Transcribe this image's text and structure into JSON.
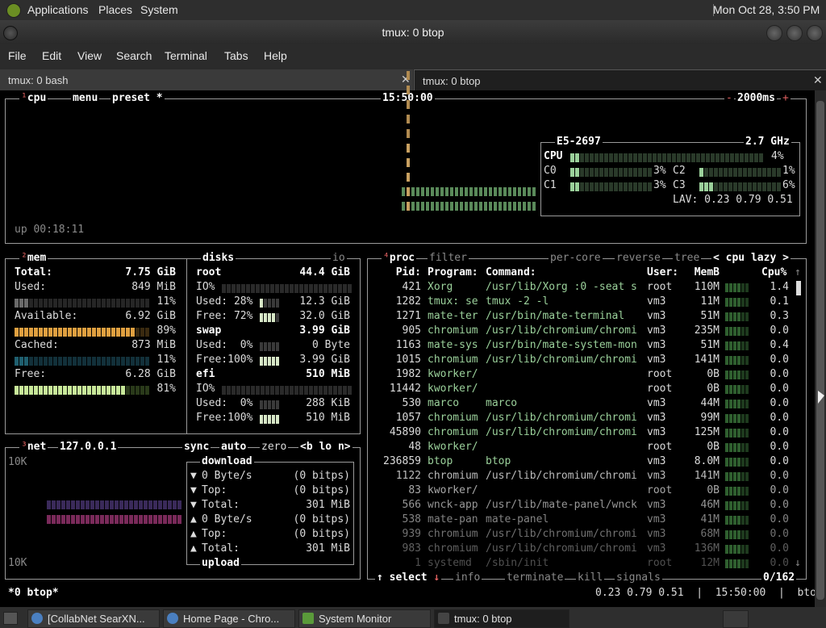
{
  "top_panel": {
    "menus": [
      "Applications",
      "Places",
      "System"
    ],
    "clock": "Mon Oct 28,  3:50 PM"
  },
  "window": {
    "title": "tmux: 0 btop"
  },
  "menubar": [
    "File",
    "Edit",
    "View",
    "Search",
    "Terminal",
    "Tabs",
    "Help"
  ],
  "tabs": [
    {
      "label": "tmux: 0 bash",
      "close": "✕"
    },
    {
      "label": "tmux: 0 btop",
      "close": "✕"
    }
  ],
  "cpu_box": {
    "title_num": "¹",
    "title": "cpu",
    "menu": "menu",
    "preset": "preset *",
    "clock": "15:50:00",
    "minus": "-",
    "interval": "2000ms",
    "plus": "+",
    "uptime": "up 00:18:11",
    "model": "E5-2697",
    "freq": "2.7 GHz",
    "cpu_label": "CPU",
    "cpu_pct": "4%",
    "cores": [
      {
        "label": "C0",
        "pct": "3%"
      },
      {
        "label": "C1",
        "pct": "3%"
      },
      {
        "label": "C2",
        "pct": "1%"
      },
      {
        "label": "C3",
        "pct": "6%"
      }
    ],
    "lav_label": "LAV:",
    "lav": "0.23 0.79 0.51"
  },
  "mem_box": {
    "title_num": "²",
    "title": "mem",
    "total_label": "Total:",
    "total": "7.75 GiB",
    "used_label": "Used:",
    "used": "849 MiB",
    "used_pct": "11%",
    "avail_label": "Available:",
    "avail": "6.92 GiB",
    "avail_pct": "89%",
    "cached_label": "Cached:",
    "cached": "873 MiB",
    "cached_pct": "11%",
    "free_label": "Free:",
    "free": "6.28 GiB",
    "free_pct": "81%"
  },
  "disks_box": {
    "title": "disks",
    "io": "io",
    "root_name": "root",
    "root_size": "44.4 GiB",
    "root_io": "IO%",
    "root_used_label": "Used: 28%",
    "root_used": "12.3 GiB",
    "root_free_label": "Free: 72%",
    "root_free": "32.0 GiB",
    "swap_name": "swap",
    "swap_size": "3.99 GiB",
    "swap_used_label": "Used:  0%",
    "swap_used": "0 Byte",
    "swap_free_label": "Free:100%",
    "swap_free": "3.99 GiB",
    "efi_name": "efi",
    "efi_size": "510 MiB",
    "efi_io": "IO%",
    "efi_used_label": "Used:  0%",
    "efi_used": "288 KiB",
    "efi_free_label": "Free:100%",
    "efi_free": "510 MiB"
  },
  "net_box": {
    "title_num": "³",
    "title": "net",
    "iface": "127.0.0.1",
    "sync": "sync",
    "auto": "auto",
    "zero": "zero",
    "nav": "<b lo n>",
    "scale_top": "10K",
    "scale_bottom": "10K",
    "download": "download",
    "upload": "upload",
    "rows": [
      {
        "arrow": "▼",
        "label": "0 Byte/s",
        "value": "(0 bitps)"
      },
      {
        "arrow": "▼",
        "label": "Top:",
        "value": "(0 bitps)"
      },
      {
        "arrow": "▼",
        "label": "Total:",
        "value": "301 MiB"
      },
      {
        "arrow": "▲",
        "label": "0 Byte/s",
        "value": "(0 bitps)"
      },
      {
        "arrow": "▲",
        "label": "Top:",
        "value": "(0 bitps)"
      },
      {
        "arrow": "▲",
        "label": "Total:",
        "value": "301 MiB"
      }
    ]
  },
  "proc_box": {
    "title_num": "⁴",
    "title": "proc",
    "filter": "filter",
    "per_core": "per-core",
    "reverse": "reverse",
    "tree": "tree",
    "sort": "< cpu lazy >",
    "headers": {
      "pid": "Pid:",
      "program": "Program:",
      "command": "Command:",
      "user": "User:",
      "mem": "MemB",
      "cpu": "Cpu%"
    },
    "rows": [
      {
        "pid": "421",
        "program": "Xorg",
        "command": "/usr/lib/Xorg :0 -seat s",
        "user": "root",
        "mem": "110M",
        "cpu": "1.4"
      },
      {
        "pid": "1282",
        "program": "tmux: se",
        "command": "tmux -2 -l",
        "user": "vm3",
        "mem": "11M",
        "cpu": "0.1"
      },
      {
        "pid": "1271",
        "program": "mate-ter",
        "command": "/usr/bin/mate-terminal",
        "user": "vm3",
        "mem": "51M",
        "cpu": "0.3"
      },
      {
        "pid": "905",
        "program": "chromium",
        "command": "/usr/lib/chromium/chromi",
        "user": "vm3",
        "mem": "235M",
        "cpu": "0.0"
      },
      {
        "pid": "1163",
        "program": "mate-sys",
        "command": "/usr/bin/mate-system-mon",
        "user": "vm3",
        "mem": "51M",
        "cpu": "0.4"
      },
      {
        "pid": "1015",
        "program": "chromium",
        "command": "/usr/lib/chromium/chromi",
        "user": "vm3",
        "mem": "141M",
        "cpu": "0.0"
      },
      {
        "pid": "1982",
        "program": "kworker/",
        "command": "",
        "user": "root",
        "mem": "0B",
        "cpu": "0.0"
      },
      {
        "pid": "11442",
        "program": "kworker/",
        "command": "",
        "user": "root",
        "mem": "0B",
        "cpu": "0.0"
      },
      {
        "pid": "530",
        "program": "marco",
        "command": "marco",
        "user": "vm3",
        "mem": "44M",
        "cpu": "0.0"
      },
      {
        "pid": "1057",
        "program": "chromium",
        "command": "/usr/lib/chromium/chromi",
        "user": "vm3",
        "mem": "99M",
        "cpu": "0.0"
      },
      {
        "pid": "45890",
        "program": "chromium",
        "command": "/usr/lib/chromium/chromi",
        "user": "vm3",
        "mem": "125M",
        "cpu": "0.0"
      },
      {
        "pid": "48",
        "program": "kworker/",
        "command": "",
        "user": "root",
        "mem": "0B",
        "cpu": "0.0"
      },
      {
        "pid": "236859",
        "program": "btop",
        "command": "btop",
        "user": "vm3",
        "mem": "8.0M",
        "cpu": "0.0"
      },
      {
        "pid": "1122",
        "program": "chromium",
        "command": "/usr/lib/chromium/chromi",
        "user": "vm3",
        "mem": "141M",
        "cpu": "0.0"
      },
      {
        "pid": "83",
        "program": "kworker/",
        "command": "",
        "user": "root",
        "mem": "0B",
        "cpu": "0.0"
      },
      {
        "pid": "566",
        "program": "wnck-app",
        "command": "/usr/lib/mate-panel/wnck",
        "user": "vm3",
        "mem": "46M",
        "cpu": "0.0"
      },
      {
        "pid": "538",
        "program": "mate-pan",
        "command": "mate-panel",
        "user": "vm3",
        "mem": "41M",
        "cpu": "0.0"
      },
      {
        "pid": "939",
        "program": "chromium",
        "command": "/usr/lib/chromium/chromi",
        "user": "vm3",
        "mem": "68M",
        "cpu": "0.0"
      },
      {
        "pid": "983",
        "program": "chromium",
        "command": "/usr/lib/chromium/chromi",
        "user": "vm3",
        "mem": "136M",
        "cpu": "0.0"
      },
      {
        "pid": "1",
        "program": "systemd",
        "command": "/sbin/init",
        "user": "root",
        "mem": "12M",
        "cpu": "0.0"
      }
    ],
    "footer": {
      "select": "select",
      "info": "info",
      "terminate": "terminate",
      "kill": "kill",
      "signals": "signals",
      "count": "0/162"
    }
  },
  "status": {
    "left": "*0 btop*",
    "right": "0.23 0.79 0.51  |  15:50:00  |  btop"
  },
  "taskbar": [
    {
      "label": "[CollabNet SearXN..."
    },
    {
      "label": "Home Page - Chro..."
    },
    {
      "label": "System Monitor"
    },
    {
      "label": "tmux: 0 btop"
    }
  ],
  "colors": {
    "accent_green": "#9bd19b",
    "available_bar": "#e0a040",
    "cached_bar": "#1f5f6f",
    "free_bar": "#c8e89a",
    "net_bar": "#7a2a5a"
  }
}
